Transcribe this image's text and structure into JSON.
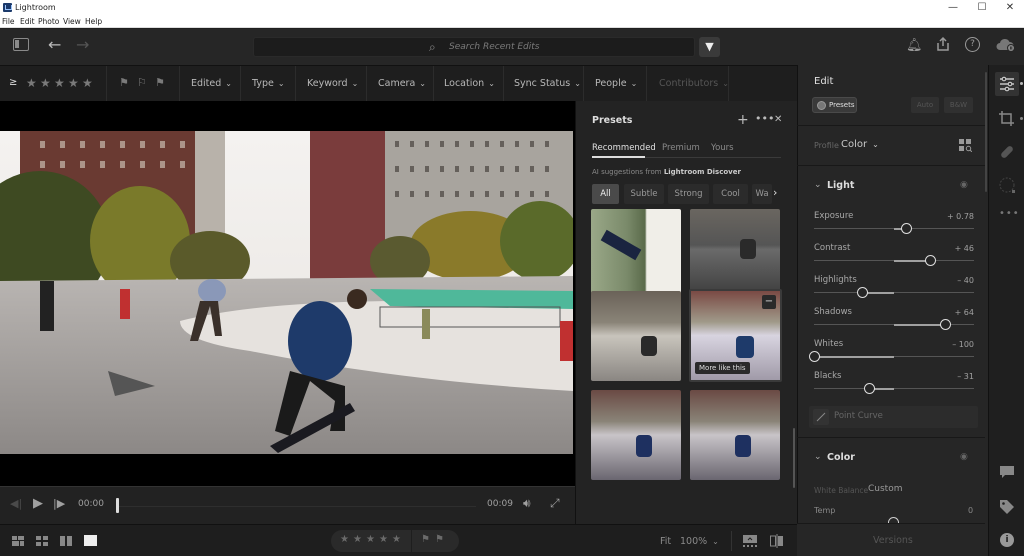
{
  "window": {
    "title": "Lightroom",
    "controls": {
      "minimize": "—",
      "maximize": "☐",
      "close": "✕"
    }
  },
  "menu": {
    "items": [
      "File",
      "Edit",
      "Photo",
      "View",
      "Help"
    ]
  },
  "toolbar": {
    "search_placeholder": "Search Recent Edits",
    "icons": [
      "panel-toggle-icon",
      "back-arrow-icon",
      "forward-arrow-icon",
      "filter-icon",
      "bell-icon",
      "share-icon",
      "help-icon",
      "cloud-sync-icon"
    ]
  },
  "filterbar": {
    "rating_operator": "≥",
    "stars": 5,
    "filters": [
      {
        "label": "Edited",
        "enabled": true
      },
      {
        "label": "Type",
        "enabled": true
      },
      {
        "label": "Keyword",
        "enabled": true
      },
      {
        "label": "Camera",
        "enabled": true
      },
      {
        "label": "Location",
        "enabled": true
      },
      {
        "label": "Sync Status",
        "enabled": true
      },
      {
        "label": "People",
        "enabled": true
      },
      {
        "label": "Contributors",
        "enabled": false
      }
    ]
  },
  "video": {
    "current_time": "00:00",
    "duration": "00:09",
    "progress": 0.0
  },
  "bottombar": {
    "fit_label": "Fit",
    "zoom_level": "100%",
    "stars": 5
  },
  "presets": {
    "title": "Presets",
    "tabs": [
      {
        "label": "Recommended",
        "active": true
      },
      {
        "label": "Premium",
        "active": false
      },
      {
        "label": "Yours",
        "active": false
      }
    ],
    "ai_note_prefix": "AI suggestions from",
    "ai_note_source": "Lightroom Discover",
    "chips": [
      {
        "label": "All",
        "active": true
      },
      {
        "label": "Subtle",
        "active": false
      },
      {
        "label": "Strong",
        "active": false
      },
      {
        "label": "Cool",
        "active": false
      },
      {
        "label": "Wa",
        "active": false
      }
    ],
    "tooltip": "More like this",
    "thumbnail_count": 6
  },
  "edit": {
    "title": "Edit",
    "presets_button": "Presets",
    "auto_button": "Auto",
    "bw_button": "B&W",
    "profile_label": "Profile",
    "profile_value": "Color",
    "light": {
      "title": "Light",
      "sliders": [
        {
          "label": "Exposure",
          "value": "+ 0.78",
          "position": 0.578
        },
        {
          "label": "Contrast",
          "value": "+ 46",
          "position": 0.73
        },
        {
          "label": "Highlights",
          "value": "– 40",
          "position": 0.3
        },
        {
          "label": "Shadows",
          "value": "+ 64",
          "position": 0.82
        },
        {
          "label": "Whites",
          "value": "– 100",
          "position": 0.0
        },
        {
          "label": "Blacks",
          "value": "– 31",
          "position": 0.345
        }
      ],
      "point_curve": "Point Curve"
    },
    "color": {
      "title": "Color",
      "wb_label": "White Balance",
      "wb_value": "Custom",
      "temp_label": "Temp",
      "temp_value": "0"
    },
    "versions": "Versions"
  }
}
